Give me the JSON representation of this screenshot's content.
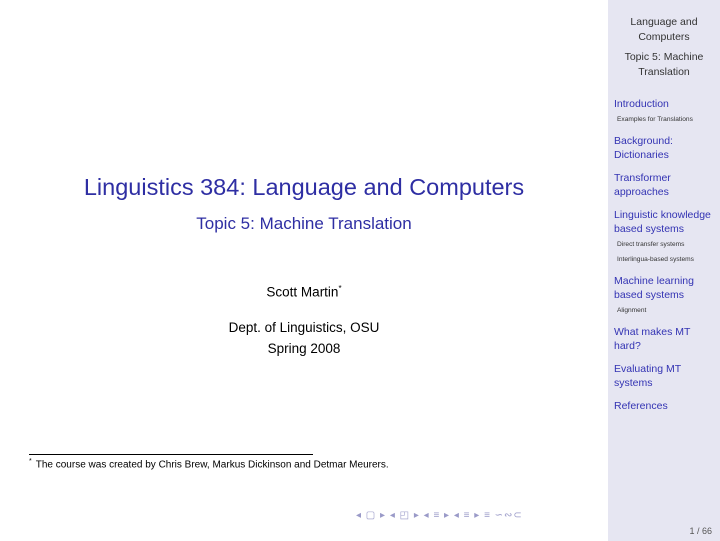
{
  "slide": {
    "title": "Linguistics 384: Language and Computers",
    "subtitle": "Topic 5: Machine Translation",
    "author": "Scott Martin",
    "author_mark": "*",
    "institution": "Dept. of Linguistics, OSU",
    "term": "Spring 2008",
    "footnote_mark": "*",
    "footnote": "The course was created by Chris Brew, Markus Dickinson and Detmar Meurers."
  },
  "sidebar": {
    "title_line1": "Language and",
    "title_line2": "Computers",
    "topic_line1": "Topic 5: Machine",
    "topic_line2": "Translation",
    "sections": [
      {
        "label": "Introduction",
        "subs": [
          "Examples for Translations"
        ]
      },
      {
        "label": "Background: Dictionaries",
        "subs": []
      },
      {
        "label": "Transformer approaches",
        "subs": []
      },
      {
        "label": "Linguistic knowledge based systems",
        "subs": [
          "Direct transfer systems",
          "Interlingua-based systems"
        ]
      },
      {
        "label": "Machine learning based systems",
        "subs": [
          "Alignment"
        ]
      },
      {
        "label": "What makes MT hard?",
        "subs": []
      },
      {
        "label": "Evaluating MT systems",
        "subs": []
      },
      {
        "label": "References",
        "subs": []
      }
    ]
  },
  "navigation": {
    "symbols": "◂ ▢ ▸ ◂ ◰ ▸ ◂ ≡ ▸ ◂ ≡ ▸ ≡ ∽∾⊂",
    "page": "1 / 66"
  }
}
